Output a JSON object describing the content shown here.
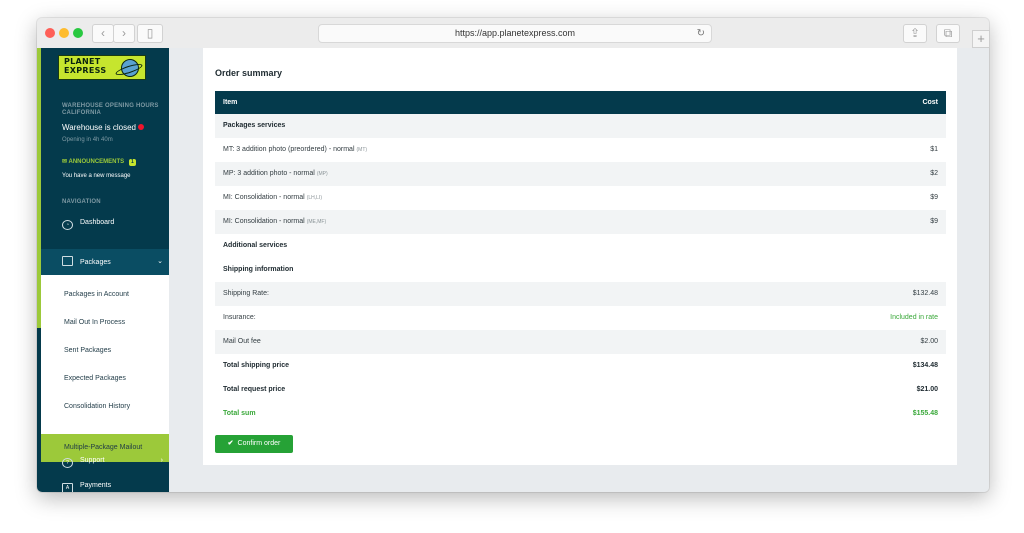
{
  "browser": {
    "url": "https://app.planetexpress.com",
    "back_icon": "chevron-left-icon",
    "forward_icon": "chevron-right-icon",
    "sidebar_icon": "sidebar-toggle-icon",
    "reload_icon": "reload-icon",
    "share_icon": "share-icon",
    "tabs_icon": "tabs-icon",
    "new_tab_icon": "plus-icon"
  },
  "sidebar": {
    "logo_line1": "PLANET",
    "logo_line2": "EXPRESS",
    "hours_label_line1": "WAREHOUSE OPENING HOURS",
    "hours_label_line2": "CALIFORNIA",
    "warehouse_status": "Warehouse is closed",
    "opening_in": "Opening in 4h 40m",
    "announcements_label": "ANNOUNCEMENTS",
    "announcements_count": "1",
    "announcement_message": "You have a new message",
    "navigation_label": "NAVIGATION",
    "nav": {
      "dashboard": "Dashboard",
      "packages": "Packages",
      "support": "Support",
      "payments": "Payments"
    },
    "submenu": [
      "Packages in Account",
      "Mail Out In Process",
      "Sent Packages",
      "Expected Packages",
      "Consolidation History",
      "Multiple-Package Mailout"
    ],
    "accent_color": "#9cc93a",
    "bg_color": "#043a4c"
  },
  "order": {
    "title": "Order summary",
    "col_item": "Item",
    "col_cost": "Cost",
    "packages_services": "Packages services",
    "services": [
      {
        "label": "MT: 3 addition photo (preordered) - normal",
        "tag": "(MT)",
        "cost": "$1"
      },
      {
        "label": "MP: 3 addition photo - normal",
        "tag": "(MP)",
        "cost": "$2"
      },
      {
        "label": "MI: Consolidation - normal",
        "tag": "(LH,LI)",
        "cost": "$9"
      },
      {
        "label": "MI: Consolidation - normal",
        "tag": "(ME,MF)",
        "cost": "$9"
      }
    ],
    "additional_services": "Additional services",
    "shipping_information": "Shipping information",
    "shipping_rate_label": "Shipping Rate:",
    "shipping_rate": "$132.48",
    "insurance_label": "Insurance:",
    "insurance_value": "Included in rate",
    "mail_out_fee_label": "Mail Out fee",
    "mail_out_fee": "$2.00",
    "total_shipping_label": "Total shipping price",
    "total_shipping": "$134.48",
    "total_request_label": "Total request price",
    "total_request": "$21.00",
    "total_sum_label": "Total sum",
    "total_sum": "$155.48",
    "confirm_button": "Confirm order",
    "green_color": "#3aa83a"
  }
}
